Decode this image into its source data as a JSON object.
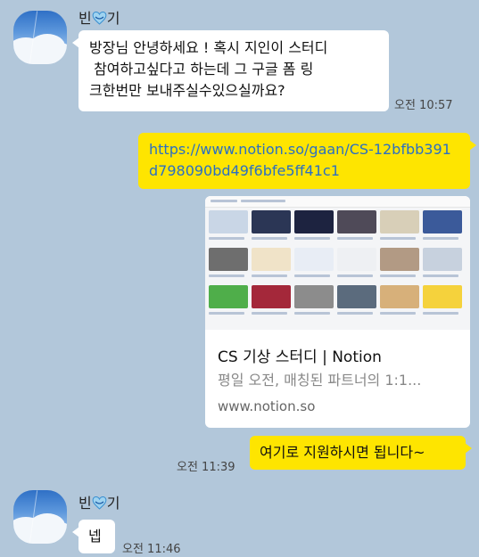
{
  "sender": {
    "name_left": "빈",
    "name_right": "기"
  },
  "messages": {
    "m1": {
      "line1": "방장님 안녕하세요 ! 혹시 지인이 스터디",
      "line2": " 참여하고싶다고 하는데 그 구글 폼 링",
      "line3": "크한번만 보내주실수있으실까요?",
      "time": "오전 10:57"
    },
    "m2": {
      "line1": "https://www.notion.so/gaan/CS-12bfbb391",
      "line2": "d798090bd49f6bfe5ff41c1"
    },
    "preview": {
      "title": "CS 기상 스터디 | Notion",
      "description": "평일 오전, 매칭된 파트너의 1:1...",
      "domain": "www.notion.so"
    },
    "m3": {
      "text": "여기로 지원하시면 됩니다~",
      "time": "오전 11:39"
    },
    "m4": {
      "text": "넵",
      "time": "오전 11:46"
    }
  },
  "colors": {
    "background": "#b2c7da",
    "my_bubble": "#fee500",
    "their_bubble": "#ffffff",
    "link": "#2a6fc4"
  },
  "icons": [
    "avatar-sky-photo",
    "blue-heart-emoji",
    "webpage-thumbnail"
  ]
}
